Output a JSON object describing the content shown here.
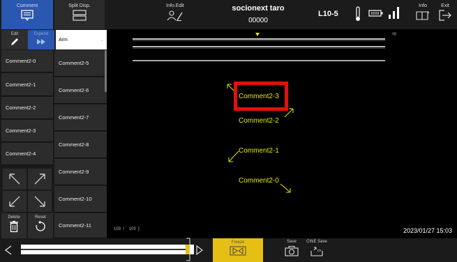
{
  "topbar": {
    "comment": "Comment",
    "split_disp": "Split Disp.",
    "info_edit": "Info.Edit",
    "patient_name": "socionext taro",
    "patient_id": "00000",
    "probe": "L10-5",
    "info": "Info",
    "exit": "Exit"
  },
  "left_panel": {
    "edit": "Edit",
    "expand": "Expend",
    "preset": "Arm",
    "col1": [
      "Comment2-0",
      "Comment2-1",
      "Comment2-2",
      "Comment2-3",
      "Comment2-4"
    ],
    "col2": [
      "Comment2-5",
      "Comment2-6",
      "Comment2-7",
      "Comment2-8",
      "Comment2-9",
      "Comment2-10",
      "Comment2-11"
    ],
    "delete": "Delete",
    "reset": "Reset"
  },
  "image_area": {
    "vp": "vp",
    "comments": [
      "Comment2-3",
      "Comment2-2",
      "Comment2-1",
      "Comment2-0"
    ],
    "frame_counter": "103  /    103  ]",
    "datetime": "2023/01/27 15:03"
  },
  "bottombar": {
    "freeze": "Freeze",
    "save": "Save",
    "cine_save": "CINE Save"
  },
  "colors": {
    "accent": "#2a57b0",
    "freeze": "#e5bf14",
    "comment_text": "#e6e600",
    "highlight": "#e01010"
  }
}
